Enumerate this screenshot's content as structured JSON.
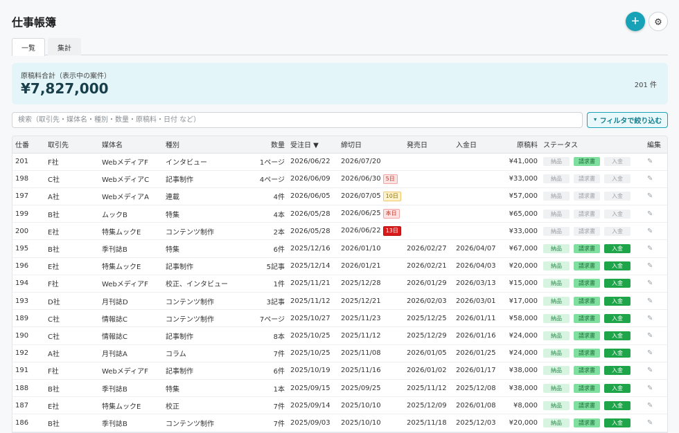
{
  "app": {
    "title": "仕事帳簿"
  },
  "tabs": [
    {
      "label": "一覧",
      "active": true
    },
    {
      "label": "集計",
      "active": false
    }
  ],
  "summary": {
    "label": "原稿料合計（表示中の案件）",
    "total": "¥7,827,000",
    "count": "201 件"
  },
  "search": {
    "placeholder": "検索（取引先・媒体名・種別・数量・原稿料・日付 など）"
  },
  "filter_button": {
    "label": "フィルタで絞り込む"
  },
  "colors": {
    "accent": "#17a2b8",
    "paid": "#1ea54a",
    "invoice": "#7fdf9e"
  },
  "icons": {
    "add": "plus-icon",
    "settings": "gear-icon",
    "edit": "pencil-icon",
    "sort": "sort-desc-icon"
  },
  "table": {
    "headers": [
      "仕番",
      "取引先",
      "媒体名",
      "種別",
      "数量",
      "受注日 ▼",
      "締切日",
      "発売日",
      "入金日",
      "原稿料",
      "ステータス",
      "編集"
    ],
    "status_labels": {
      "delivered": "納品",
      "invoice": "請求書",
      "paid": "入金"
    },
    "rows": [
      {
        "id": "201",
        "client": "F社",
        "media": "WebメディアF",
        "kind": "インタビュー",
        "qty": "1ページ",
        "order": "2026/06/22",
        "deadline": "2026/07/20",
        "badge": "",
        "badge_type": "",
        "release": "",
        "paid_date": "",
        "fee": "¥41,000",
        "status": 1
      },
      {
        "id": "198",
        "client": "C社",
        "media": "WebメディアC",
        "kind": "記事制作",
        "qty": "4ページ",
        "order": "2026/06/09",
        "deadline": "2026/06/30",
        "badge": "5日",
        "badge_type": "red",
        "release": "",
        "paid_date": "",
        "fee": "¥33,000",
        "status": 0
      },
      {
        "id": "197",
        "client": "A社",
        "media": "WebメディアA",
        "kind": "連載",
        "qty": "4件",
        "order": "2026/06/05",
        "deadline": "2026/07/05",
        "badge": "10日",
        "badge_type": "amber",
        "release": "",
        "paid_date": "",
        "fee": "¥57,000",
        "status": 0
      },
      {
        "id": "199",
        "client": "B社",
        "media": "ムックB",
        "kind": "特集",
        "qty": "4本",
        "order": "2026/05/28",
        "deadline": "2026/06/25",
        "badge": "本日",
        "badge_type": "red",
        "release": "",
        "paid_date": "",
        "fee": "¥65,000",
        "status": 0
      },
      {
        "id": "200",
        "client": "E社",
        "media": "特集ムックE",
        "kind": "コンテンツ制作",
        "qty": "2本",
        "order": "2026/05/28",
        "deadline": "2026/06/22",
        "badge": "13日",
        "badge_type": "darkred",
        "release": "",
        "paid_date": "",
        "fee": "¥33,000",
        "status": 0
      },
      {
        "id": "195",
        "client": "B社",
        "media": "季刊誌B",
        "kind": "特集",
        "qty": "6件",
        "order": "2025/12/16",
        "deadline": "2026/01/10",
        "badge": "",
        "badge_type": "",
        "release": "2026/02/27",
        "paid_date": "2026/04/07",
        "fee": "¥67,000",
        "status": 3
      },
      {
        "id": "196",
        "client": "E社",
        "media": "特集ムックE",
        "kind": "記事制作",
        "qty": "5記事",
        "order": "2025/12/14",
        "deadline": "2026/01/21",
        "badge": "",
        "badge_type": "",
        "release": "2026/02/21",
        "paid_date": "2026/04/03",
        "fee": "¥20,000",
        "status": 3
      },
      {
        "id": "194",
        "client": "F社",
        "media": "WebメディアF",
        "kind": "校正、インタビュー",
        "qty": "1件",
        "order": "2025/11/21",
        "deadline": "2025/12/28",
        "badge": "",
        "badge_type": "",
        "release": "2026/01/29",
        "paid_date": "2026/03/13",
        "fee": "¥15,000",
        "status": 3
      },
      {
        "id": "193",
        "client": "D社",
        "media": "月刊誌D",
        "kind": "コンテンツ制作",
        "qty": "3記事",
        "order": "2025/11/12",
        "deadline": "2025/12/21",
        "badge": "",
        "badge_type": "",
        "release": "2026/02/03",
        "paid_date": "2026/03/01",
        "fee": "¥17,000",
        "status": 3
      },
      {
        "id": "189",
        "client": "C社",
        "media": "情報誌C",
        "kind": "コンテンツ制作",
        "qty": "7ページ",
        "order": "2025/10/27",
        "deadline": "2025/11/23",
        "badge": "",
        "badge_type": "",
        "release": "2025/12/25",
        "paid_date": "2026/01/11",
        "fee": "¥58,000",
        "status": 3
      },
      {
        "id": "190",
        "client": "C社",
        "media": "情報誌C",
        "kind": "記事制作",
        "qty": "8本",
        "order": "2025/10/25",
        "deadline": "2025/11/12",
        "badge": "",
        "badge_type": "",
        "release": "2025/12/29",
        "paid_date": "2026/01/16",
        "fee": "¥24,000",
        "status": 3
      },
      {
        "id": "192",
        "client": "A社",
        "media": "月刊誌A",
        "kind": "コラム",
        "qty": "7件",
        "order": "2025/10/25",
        "deadline": "2025/11/08",
        "badge": "",
        "badge_type": "",
        "release": "2026/01/05",
        "paid_date": "2026/01/25",
        "fee": "¥24,000",
        "status": 3
      },
      {
        "id": "191",
        "client": "F社",
        "media": "WebメディアF",
        "kind": "記事制作",
        "qty": "6件",
        "order": "2025/10/19",
        "deadline": "2025/11/16",
        "badge": "",
        "badge_type": "",
        "release": "2026/01/02",
        "paid_date": "2026/01/17",
        "fee": "¥38,000",
        "status": 3
      },
      {
        "id": "188",
        "client": "B社",
        "media": "季刊誌B",
        "kind": "特集",
        "qty": "1本",
        "order": "2025/09/15",
        "deadline": "2025/09/25",
        "badge": "",
        "badge_type": "",
        "release": "2025/11/12",
        "paid_date": "2025/12/08",
        "fee": "¥38,000",
        "status": 3
      },
      {
        "id": "187",
        "client": "E社",
        "media": "特集ムックE",
        "kind": "校正",
        "qty": "7件",
        "order": "2025/09/14",
        "deadline": "2025/10/10",
        "badge": "",
        "badge_type": "",
        "release": "2025/12/09",
        "paid_date": "2026/01/08",
        "fee": "¥8,000",
        "status": 3
      },
      {
        "id": "186",
        "client": "B社",
        "media": "季刊誌B",
        "kind": "コンテンツ制作",
        "qty": "7件",
        "order": "2025/09/03",
        "deadline": "2025/10/10",
        "badge": "",
        "badge_type": "",
        "release": "2025/11/18",
        "paid_date": "2025/12/03",
        "fee": "¥20,000",
        "status": 3
      }
    ]
  }
}
